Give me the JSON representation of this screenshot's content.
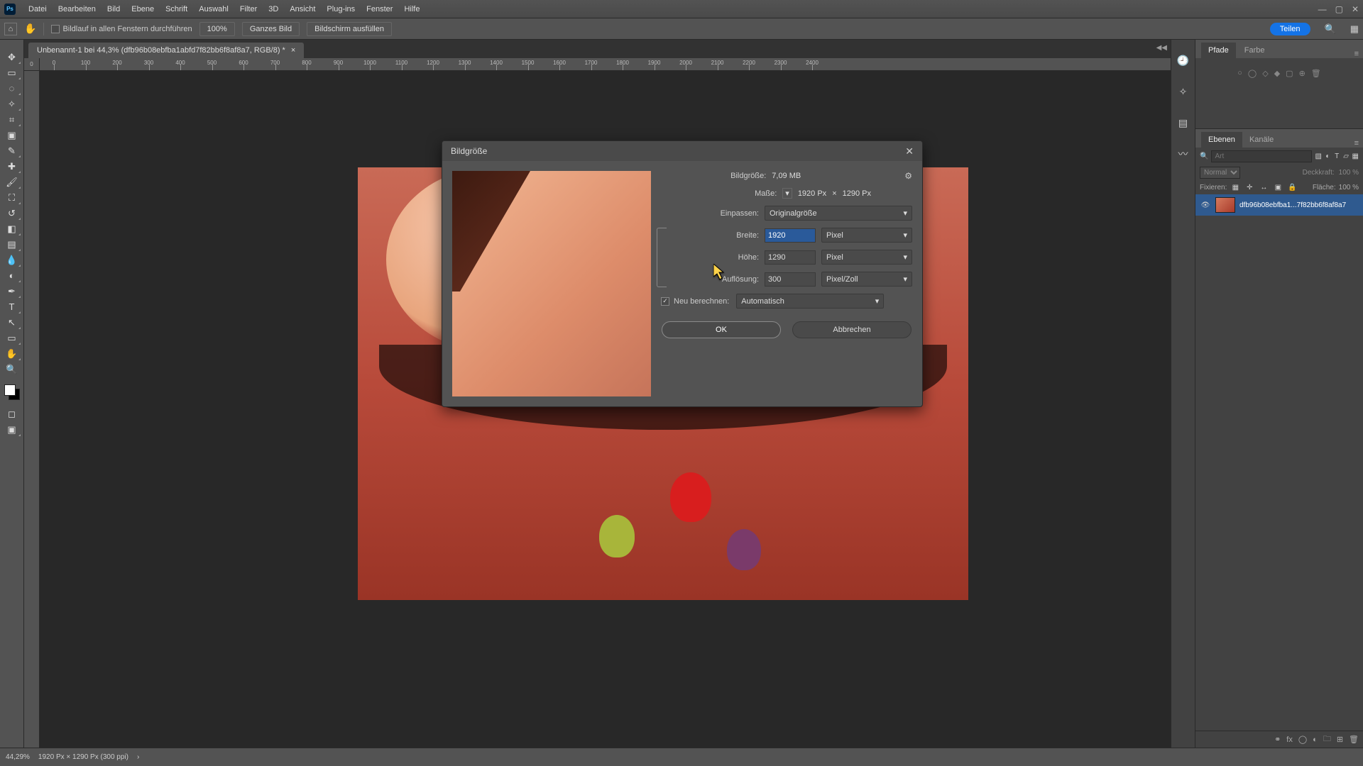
{
  "app": {
    "icon_label": "Ps"
  },
  "menu": [
    "Datei",
    "Bearbeiten",
    "Bild",
    "Ebene",
    "Schrift",
    "Auswahl",
    "Filter",
    "3D",
    "Ansicht",
    "Plug-ins",
    "Fenster",
    "Hilfe"
  ],
  "optionsbar": {
    "scroll_all_label": "Bildlauf in allen Fenstern durchführen",
    "percent_label": "100%",
    "fit_label": "Ganzes Bild",
    "fill_label": "Bildschirm ausfüllen",
    "share_label": "Teilen"
  },
  "document_tab": {
    "title": "Unbenannt-1 bei 44,3% (dfb96b08ebfba1abfd7f82bb6f8af8a7, RGB/8) *"
  },
  "ruler": {
    "corner": "0",
    "ticks": [
      "0",
      "100",
      "200",
      "300",
      "400",
      "500",
      "600",
      "700",
      "800",
      "900",
      "1000",
      "1100",
      "1200",
      "1300",
      "1400",
      "1500",
      "1600",
      "1700",
      "1800",
      "1900",
      "2000",
      "2100",
      "2200",
      "2300",
      "2400"
    ]
  },
  "right_panel": {
    "tab_paths": "Pfade",
    "tab_color": "Farbe",
    "tab_layers": "Ebenen",
    "tab_channels": "Kanäle",
    "search_placeholder": "Art",
    "blend_mode": "Normal",
    "opacity_label": "Deckkraft:",
    "opacity_value": "100 %",
    "lock_label": "Fixieren:",
    "fill_label": "Fläche:",
    "fill_value": "100 %",
    "layer_name": "dfb96b08ebfba1...7f82bb6f8af8a7"
  },
  "statusbar": {
    "zoom": "44,29%",
    "info": "1920 Px × 1290 Px (300 ppi)"
  },
  "dialog": {
    "title": "Bildgröße",
    "image_size_label": "Bildgröße:",
    "image_size_value": "7,09 MB",
    "dimensions_label": "Maße:",
    "dimensions_value_w": "1920 Px",
    "dimensions_times": "×",
    "dimensions_value_h": "1290 Px",
    "fit_label": "Einpassen:",
    "fit_value": "Originalgröße",
    "width_label": "Breite:",
    "width_value": "1920",
    "width_unit": "Pixel",
    "height_label": "Höhe:",
    "height_value": "1290",
    "height_unit": "Pixel",
    "resolution_label": "Auflösung:",
    "resolution_value": "300",
    "resolution_unit": "Pixel/Zoll",
    "resample_label": "Neu berechnen:",
    "resample_value": "Automatisch",
    "ok_label": "OK",
    "cancel_label": "Abbrechen"
  }
}
